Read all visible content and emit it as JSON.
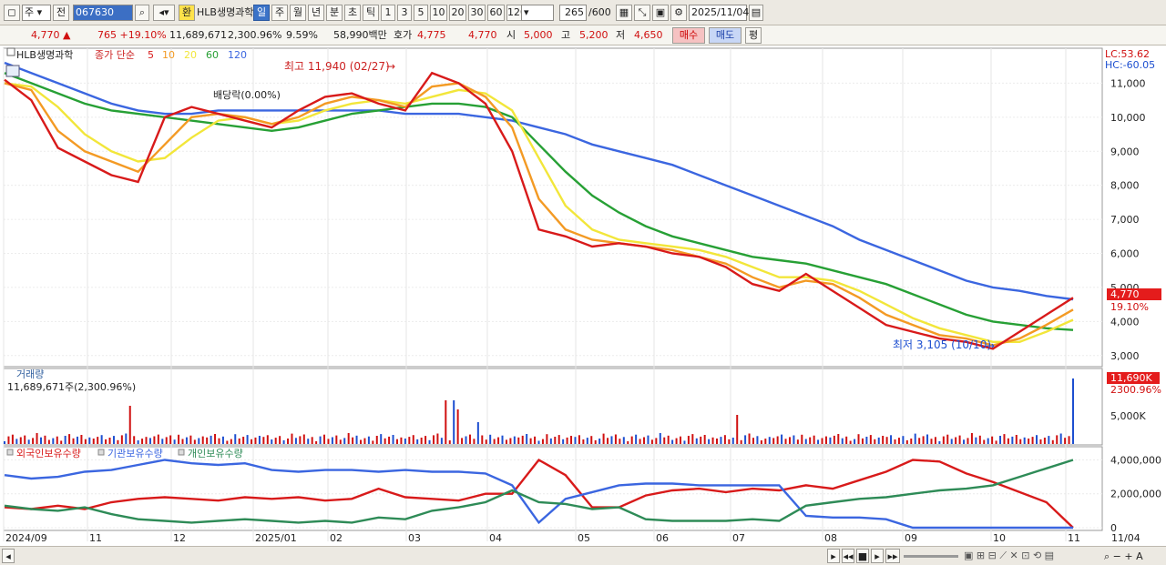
{
  "toolbar": {
    "type_select": "주",
    "prev_label": "전",
    "code": "067630",
    "loan_badge": "환",
    "stock_name": "HLB생명과학",
    "periods": [
      "일",
      "주",
      "월",
      "년",
      "분",
      "초",
      "틱"
    ],
    "active_period": "일",
    "intervals": [
      "1",
      "3",
      "5",
      "10",
      "20",
      "30",
      "60",
      "120"
    ],
    "count": "265",
    "count_total": "/600",
    "date": "2025/11/04"
  },
  "quote": {
    "price": "4,770",
    "change": "765",
    "change_pct": "+19.10%",
    "volume": "11,689,671",
    "volume_pct": "2,300.96%",
    "turnover_pct": "9.59%",
    "amount": "58,990백만",
    "bid_label": "호가",
    "ask": "4,775",
    "bid": "4,770",
    "open_label": "시",
    "open": "5,000",
    "high_label": "고",
    "high": "5,200",
    "low_label": "저",
    "low": "4,650",
    "buy_button": "매수",
    "sell_button": "매도",
    "eval_button": "평"
  },
  "colors": {
    "up": "#d01010",
    "down": "#1d4fd0",
    "ma5": "#d81a1a",
    "ma10": "#f39a24",
    "ma20": "#f2e63a",
    "ma60": "#27a035",
    "ma120": "#3b66e0",
    "foreign": "#d81a1a",
    "institution": "#3b66e0",
    "individual": "#2e8b57"
  },
  "price_panel": {
    "name": "HLB생명과학",
    "legend_prefix": "종가 단순",
    "ma_periods": [
      "5",
      "10",
      "20",
      "60",
      "120"
    ],
    "lc": "LC:53.62",
    "hc": "HC:-60.05",
    "high_note": "최고 11,940 (02/27)",
    "low_note": "최저 3,105 (10/10)",
    "dividend_note": "배당락(0.00%)",
    "last_price_tag": "4,770",
    "last_pct_tag": "19.10%",
    "y_ticks": [
      "11,000",
      "10,000",
      "9,000",
      "8,000",
      "7,000",
      "6,000",
      "5,000",
      "4,000",
      "3,000"
    ]
  },
  "volume_panel": {
    "title": "거래량",
    "value": "11,689,671주(2,300.96%)",
    "last_tag": "11,690K",
    "last_pct_tag": "2300.96%",
    "y_tick": "5,000K"
  },
  "holdings_panel": {
    "series": [
      "외국인보유수량",
      "기관보유수량",
      "개인보유수량"
    ],
    "y_ticks": [
      "4,000,000",
      "2,000,000",
      "0"
    ]
  },
  "x_axis": {
    "labels": [
      "2024/09",
      "11",
      "12",
      "2025/01",
      "02",
      "03",
      "04",
      "05",
      "06",
      "07",
      "08",
      "09",
      "10",
      "11",
      "11/04"
    ]
  },
  "chart_data": [
    {
      "type": "line",
      "title": "HLB생명과학",
      "ylim": [
        2700,
        12000
      ],
      "note": "daily price ~ closing trajectory",
      "series": [
        {
          "name": "5",
          "values": [
            11100,
            10500,
            9100,
            8700,
            8300,
            8100,
            10000,
            10300,
            10100,
            9900,
            9700,
            10200,
            10600,
            10700,
            10400,
            10200,
            11300,
            11000,
            10400,
            9000,
            6700,
            6500,
            6200,
            6300,
            6200,
            6000,
            5900,
            5600,
            5100,
            4900,
            5400,
            4900,
            4400,
            3900,
            3700,
            3500,
            3400,
            3200,
            3700,
            4200,
            4700
          ]
        },
        {
          "name": "10",
          "values": [
            11000,
            10800,
            9600,
            9000,
            8700,
            8400,
            9200,
            10000,
            10100,
            10000,
            9800,
            10000,
            10400,
            10600,
            10500,
            10300,
            10900,
            11000,
            10600,
            9700,
            7600,
            6700,
            6400,
            6300,
            6200,
            6100,
            5900,
            5700,
            5300,
            5000,
            5200,
            5100,
            4700,
            4200,
            3900,
            3600,
            3500,
            3300,
            3500,
            3900,
            4350
          ]
        },
        {
          "name": "20",
          "values": [
            11000,
            10900,
            10300,
            9500,
            9000,
            8700,
            8800,
            9400,
            9900,
            10000,
            9800,
            9900,
            10200,
            10400,
            10500,
            10400,
            10600,
            10800,
            10700,
            10200,
            8800,
            7400,
            6700,
            6400,
            6300,
            6200,
            6100,
            5900,
            5600,
            5300,
            5300,
            5200,
            4900,
            4500,
            4100,
            3800,
            3600,
            3400,
            3400,
            3700,
            4050
          ]
        },
        {
          "name": "60",
          "values": [
            11300,
            11000,
            10700,
            10400,
            10200,
            10100,
            10000,
            9900,
            9800,
            9700,
            9600,
            9700,
            9900,
            10100,
            10200,
            10300,
            10400,
            10400,
            10300,
            10000,
            9200,
            8400,
            7700,
            7200,
            6800,
            6500,
            6300,
            6100,
            5900,
            5800,
            5700,
            5500,
            5300,
            5100,
            4800,
            4500,
            4200,
            4000,
            3900,
            3800,
            3750
          ]
        },
        {
          "name": "120",
          "values": [
            11600,
            11300,
            11000,
            10700,
            10400,
            10200,
            10100,
            10100,
            10200,
            10200,
            10200,
            10200,
            10200,
            10200,
            10200,
            10100,
            10100,
            10100,
            10000,
            9900,
            9700,
            9500,
            9200,
            9000,
            8800,
            8600,
            8300,
            8000,
            7700,
            7400,
            7100,
            6800,
            6400,
            6100,
            5800,
            5500,
            5200,
            5000,
            4900,
            4750,
            4650
          ]
        }
      ]
    },
    {
      "type": "line",
      "title": "",
      "ylim": [
        0,
        4400000
      ],
      "series": [
        {
          "name": "외국인보유수량",
          "values": [
            1200000,
            1100000,
            1300000,
            1100000,
            1500000,
            1700000,
            1800000,
            1700000,
            1600000,
            1800000,
            1700000,
            1800000,
            1600000,
            1700000,
            2300000,
            1800000,
            1700000,
            1600000,
            2000000,
            2000000,
            4000000,
            3100000,
            1200000,
            1200000,
            1900000,
            2200000,
            2300000,
            2100000,
            2300000,
            2200000,
            2500000,
            2300000,
            2800000,
            3300000,
            4000000,
            3900000,
            3200000,
            2700000,
            2100000,
            1500000,
            0
          ]
        },
        {
          "name": "기관보유수량",
          "values": [
            3100000,
            2900000,
            3000000,
            3300000,
            3400000,
            3700000,
            4000000,
            3800000,
            3700000,
            3800000,
            3400000,
            3300000,
            3400000,
            3400000,
            3300000,
            3400000,
            3300000,
            3300000,
            3200000,
            2500000,
            300000,
            1700000,
            2100000,
            2500000,
            2600000,
            2600000,
            2500000,
            2500000,
            2500000,
            2500000,
            700000,
            600000,
            600000,
            500000,
            0,
            0,
            0,
            0,
            0,
            0,
            0
          ]
        },
        {
          "name": "개인보유수량",
          "values": [
            1300000,
            1100000,
            1000000,
            1200000,
            800000,
            500000,
            400000,
            300000,
            400000,
            500000,
            400000,
            300000,
            400000,
            300000,
            600000,
            500000,
            1000000,
            1200000,
            1500000,
            2200000,
            1500000,
            1400000,
            1100000,
            1200000,
            500000,
            400000,
            400000,
            400000,
            500000,
            400000,
            1300000,
            1500000,
            1700000,
            1800000,
            2000000,
            2200000,
            2300000,
            2500000,
            3000000,
            3500000,
            4000000
          ]
        }
      ]
    }
  ]
}
